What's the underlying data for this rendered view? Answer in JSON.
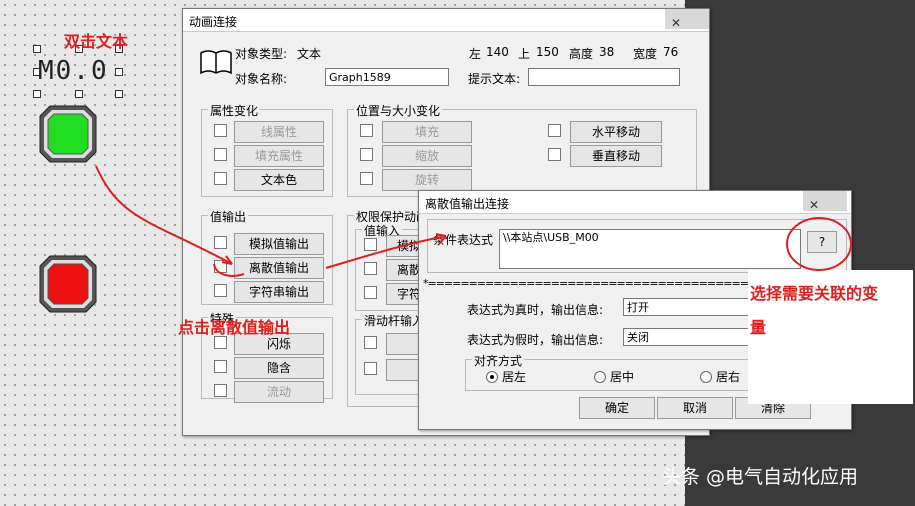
{
  "canvas": {
    "selected_text": "M0.0",
    "lamp_on_color": "#22dd22",
    "lamp_off_color": "#ee1111"
  },
  "main_dialog": {
    "title": "动画连接",
    "close_glyph": "✕",
    "object_type_label": "对象类型:",
    "object_type_value": "文本",
    "left_label": "左",
    "left_value": "140",
    "top_label": "上",
    "top_value": "150",
    "height_label": "高度",
    "height_value": "38",
    "width_label": "宽度",
    "width_value": "76",
    "object_name_label": "对象名称:",
    "object_name_value": "Graph1589",
    "hint_label": "提示文本:",
    "hint_value": "",
    "group_attr": "属性变化",
    "btn_line_attr": "线属性",
    "btn_fill_attr": "填充属性",
    "btn_text_color": "文本色",
    "group_pos": "位置与大小变化",
    "btn_fill": "填充",
    "btn_scale": "缩放",
    "btn_rotate": "旋转",
    "btn_hmove": "水平移动",
    "btn_vmove": "垂直移动",
    "group_value_out": "值输出",
    "btn_analog_out": "模拟值输出",
    "btn_discrete_out": "离散值输出",
    "btn_string_out": "字符串输出",
    "group_perm": "权限保护动画",
    "group_value_in": "值输入",
    "btn_analog_in": "模拟",
    "btn_discrete_in": "离散",
    "btn_string_in": "字符",
    "group_special": "特殊",
    "btn_blink": "闪烁",
    "btn_hide": "隐含",
    "btn_flow": "流动",
    "group_slider": "滑动杆输入",
    "btn_slider1": "水",
    "btn_slider2": "垂"
  },
  "sub_dialog": {
    "title": "离散值输出连接",
    "close_glyph": "✕",
    "cond_label": "条件表达式",
    "cond_value": "\\\\本站点\\USB_M00",
    "browse_button": "?",
    "separator": "*====================================================================",
    "true_label": "表达式为真时，输出信息:",
    "true_value": "打开",
    "false_label": "表达式为假时，输出信息:",
    "false_value": "关闭",
    "align_group": "对齐方式",
    "align_left": "居左",
    "align_center": "居中",
    "align_right": "居右",
    "ok_button": "确定",
    "cancel_button": "取消",
    "clear_button": "清除"
  },
  "annotations": {
    "double_click": "双击文本",
    "click_discrete": "点击离散值输出",
    "select_var_line1": "选择需要关联的变",
    "select_var_line2": "量",
    "watermark": "头条 @电气自动化应用"
  }
}
